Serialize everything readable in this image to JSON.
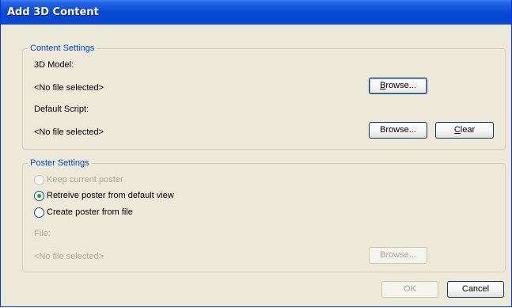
{
  "window": {
    "title": "Add 3D Content"
  },
  "content_settings": {
    "legend": "Content Settings",
    "model_label": "3D Model:",
    "model_value": "<No file selected>",
    "browse_model_prefix": "B",
    "browse_model_rest": "rowse...",
    "script_label": "Default Script:",
    "script_value": "<No file selected>",
    "browse_script": "Browse...",
    "clear_prefix": "C",
    "clear_rest": "lear"
  },
  "poster_settings": {
    "legend": "Poster Settings",
    "options": [
      {
        "label": "Keep current poster",
        "enabled": false,
        "selected": false
      },
      {
        "label": "Retreive poster from default view",
        "enabled": true,
        "selected": true
      },
      {
        "label": "Create poster from file",
        "enabled": true,
        "selected": false
      }
    ],
    "file_label": "File:",
    "file_value": "<No file selected>",
    "browse_file": "Browse..."
  },
  "footer": {
    "ok": "OK",
    "cancel": "Cancel"
  }
}
